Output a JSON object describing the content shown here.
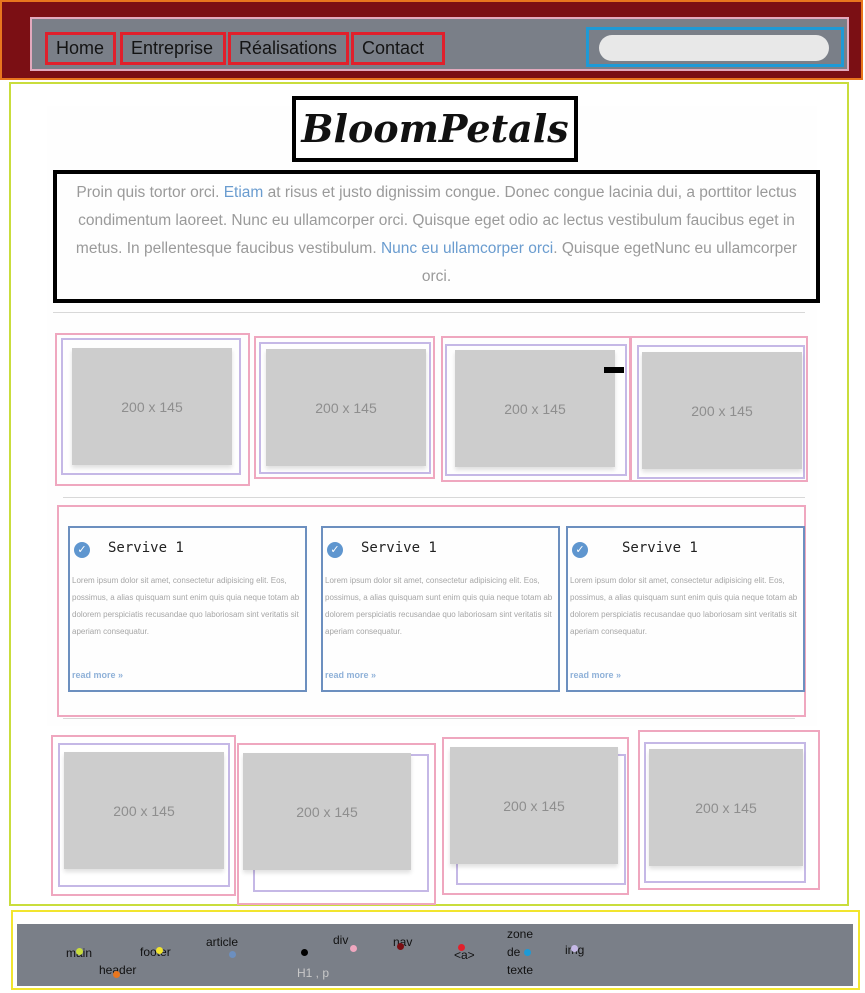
{
  "nav": {
    "links": [
      "Home",
      "Entreprise",
      "Réalisations",
      "Contact"
    ],
    "search_placeholder": ""
  },
  "main": {
    "title": "BloomPetals",
    "intro": {
      "p1": "Proin quis tortor orci. ",
      "link1": "Etiam",
      "p2": " at risus et justo dignissim congue. Donec congue lacinia dui, a porttitor lectus condimentum laoreet. Nunc eu ullamcorper orci. Quisque eget odio ac lectus vestibulum faucibus eget in metus. In pellentesque faucibus vestibulum. ",
      "link2": "Nunc eu ullamcorper orci",
      "p3": ". Quisque egetNunc eu ullamcorper orci."
    },
    "images_top": [
      "200 x 145",
      "200 x 145",
      "200 x 145",
      "200 x 145"
    ],
    "services": [
      {
        "title": "Servive 1",
        "body": "Lorem ipsum dolor sit amet, consectetur adipisicing elit. Eos, possimus, a alias quisquam sunt enim quis quia neque totam ab dolorem perspiciatis recusandae quo laboriosam sint veritatis sit aperiam consequatur.",
        "more": "read more »"
      },
      {
        "title": "Servive 1",
        "body": "Lorem ipsum dolor sit amet, consectetur adipisicing elit. Eos, possimus, a alias quisquam sunt enim quis quia neque totam ab dolorem perspiciatis recusandae quo laboriosam sint veritatis sit aperiam consequatur.",
        "more": "read more »"
      },
      {
        "title": "Servive 1",
        "body": "Lorem ipsum dolor sit amet, consectetur adipisicing elit. Eos, possimus, a alias quisquam sunt enim quis quia neque totam ab dolorem perspiciatis recusandae quo laboriosam sint veritatis sit aperiam consequatur.",
        "more": "read more »"
      }
    ],
    "images_bottom": [
      "200 x 145",
      "200 x 145",
      "200 x 145",
      "200 x 145"
    ]
  },
  "legend": {
    "main": "main",
    "header": "header",
    "footer": "footer",
    "article": "article",
    "h1p": "H1 , p",
    "div": "div",
    "nav": "nav",
    "a": "<a>",
    "zone1": "zone",
    "zone2": "de",
    "zone3": "texte",
    "img": "img"
  },
  "colors": {
    "main": "#c9dd3c",
    "header": "#e8761e",
    "footer": "#f2e52e",
    "article": "#6c8fbf",
    "h1p": "#000000",
    "div": "#efa7bf",
    "nav": "#7b0f14",
    "a": "#e1202b",
    "zone": "#1e9ad6",
    "img": "#c5b8e6"
  }
}
